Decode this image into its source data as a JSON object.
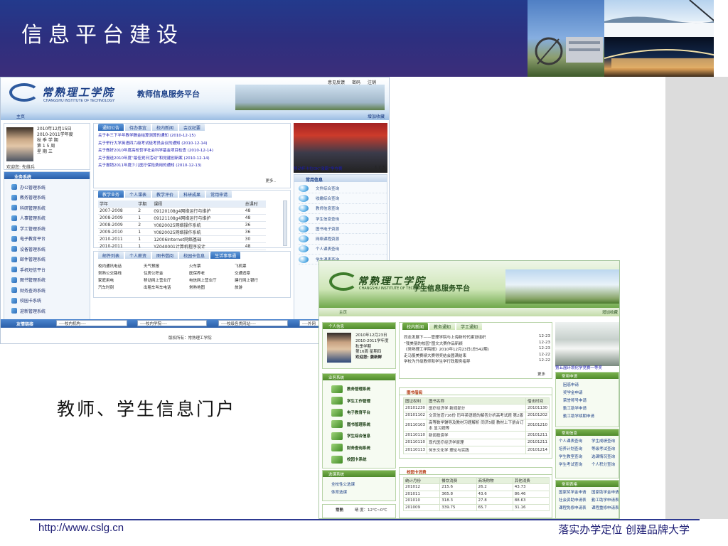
{
  "slide": {
    "title": "信息平台建设",
    "caption": "教师、学生信息门户",
    "footer_url": "http://www.cslg.cn",
    "footer_motto": "落实办学定位 创建品牌大学"
  },
  "teacher_portal": {
    "school_name": "常熟理工学院",
    "school_name_en": "CHANGSHU INSTITUTE OF TECHNOLOGY",
    "system_name": "教师信息服务平台",
    "top_links": [
      "意见反馈",
      "密码",
      "注销"
    ],
    "nav_home": "主页",
    "nav_favorite": "增加收藏",
    "info": {
      "date_lines": [
        "2010年12月15日",
        "2010-2011学年度",
        "秋 季 学 期",
        "第 1 5 周",
        "星 期 三"
      ],
      "welcome": "欢迎您: 先维兵"
    },
    "business": {
      "header": "业务系统",
      "items": [
        "办公管理系统",
        "教务管理系统",
        "科研管理系统",
        "人事管理系统",
        "学工管理系统",
        "电子教育平台",
        "设备管理系统",
        "邮件管理系统",
        "手机短信平台",
        "图书管理系统",
        "财务查询系统",
        "校园卡系统",
        "迎新管理系统"
      ]
    },
    "notice_tabs": [
      "通知公告",
      "待办事宜",
      "校内新闻",
      "会议纪要"
    ],
    "notices": [
      "关于丰三下半年教学酬金结算测算的通知 (2010-12-15)",
      "关于举行大学英语四六级考试徒考员会议的通知 (2010-12-14)",
      "关于做好2010年度高校哲学社会科学基金项目检查 (2010-12-14)",
      "关于报送2010年度“最佳党日活动”和党建创新案 (2010-12-14)",
      "关于报销2011年度少儿医疗保险费用的通知 (2010-12-13)"
    ],
    "notice_more": "更多..",
    "photo_caption": "移动杯卡拉OK“激霸”争夺赛",
    "photo_pages": "1 2 3",
    "course_tabs": [
      "教学业务",
      "个人课表",
      "教学评价",
      "科研成果",
      "常用申请"
    ],
    "course_table": {
      "headers": [
        "学年",
        "学期",
        "课程",
        "总课时"
      ],
      "rows": [
        [
          "2007-2008",
          "2",
          "09120108g4网络运行与维护",
          "48"
        ],
        [
          "2008-2009",
          "1",
          "09121108g4网络运行与维护",
          "48"
        ],
        [
          "2008-2009",
          "2",
          "Y0820025网络操作系统",
          "36"
        ],
        [
          "2009-2010",
          "1",
          "Y0820025网络操作系统",
          "36"
        ],
        [
          "2010-2011",
          "1",
          "12006Internet网络基础",
          "30"
        ],
        [
          "2010-2011",
          "1",
          "YZ040001计算机程序设计",
          "48"
        ]
      ]
    },
    "link_tabs": [
      "邮件列表",
      "个人薪资",
      "图书借阅",
      "校园卡信息",
      "生活事事通"
    ],
    "life_links": [
      "校内通讯电话",
      "天气预报",
      "火车票",
      "飞机票",
      "常熟公交路线",
      "住房公积金",
      "医保养老",
      "交通违章",
      "家庭用电",
      "移动网上营业厅",
      "电信网上营业厅",
      "建行网上银行",
      "汽车时刻",
      "出租车叫车电话",
      "常熟地图",
      "旅游"
    ],
    "friend_links": {
      "label": "友情链接",
      "selects": [
        "----校内机构----",
        "----校内学院----",
        "----校级各类网站----",
        "----外网"
      ]
    },
    "common": {
      "header": "常用信息",
      "items": [
        "文件综合查询",
        "收缴综合查询",
        "教师信息查询",
        "学生信息查询",
        "图书电子资源",
        "网络课程资源",
        "个人课表查询",
        "学生课表查询"
      ]
    },
    "copyright": "版权所有：常熟理工学院"
  },
  "student_portal": {
    "school_name": "常熟理工学院",
    "school_name_en": "CHANGSHU INSTITUTE OF TECHNOLOGY",
    "system_name": "学生信息服务平台",
    "nav_home": "主页",
    "nav_favorite": "增加收藏",
    "info": {
      "header": "个人信息",
      "date_lines": [
        "2010年12月23日",
        "2010-2011学年度",
        "秋季学期",
        "第16周 星期四"
      ],
      "welcome": "欢迎您: 姜新鲜"
    },
    "business": {
      "header": "业务系统",
      "items": [
        "教务管理系统",
        "学生工作管理",
        "电子教育平台",
        "图书管理系统",
        "学生综合信息",
        "财务查询系统",
        "校园卡系统"
      ]
    },
    "select_course": {
      "header": "选课系统",
      "items": [
        "全校性公选课",
        "体育选课"
      ]
    },
    "weather": {
      "label": "常熟",
      "text": "晴 度：12℃~0℃"
    },
    "news_tabs": [
      "校内新闻",
      "教务通知",
      "学工通知"
    ],
    "news": [
      {
        "title": "同走发展下——管理学院与上海新时代建设组织",
        "date": "12-23"
      },
      {
        "title": "“我美丽的校园”图文大赛作品新颖",
        "date": "12-23"
      },
      {
        "title": "《常熟理工学院报》2010年12月23日(总542期)",
        "date": "12-23"
      },
      {
        "title": "走马服美赛绩大赛得奖结会圆满结束",
        "date": "12-22"
      },
      {
        "title": "学校为升级教师和学生学行政服务指导",
        "date": "12-22"
      }
    ],
    "news_more": "更多",
    "photo_caption": "第五届环境化学竞赛一等奖",
    "library": {
      "header": "图书借阅",
      "headers": [
        "图证权利",
        "图书名称",
        "借出时间"
      ],
      "rows": [
        [
          "20101230",
          "医疗经济学 新闻部分",
          "20101130"
        ],
        [
          "20101102",
          "交流信道716份 历年英语题的解答分析高考试题 第2版",
          "20101202"
        ],
        [
          "20110103",
          "高等数学辅导及教材习题解析 同济5版 教材上下册合订本 显习题等",
          "20101210"
        ],
        [
          "20110110",
          "新闻投资学",
          "20101211"
        ],
        [
          "20110110",
          "现代医疗经济学原理",
          "20101211"
        ],
        [
          "20110113",
          "何东文化学 理论与实践",
          "20101214"
        ]
      ]
    },
    "campus_card": {
      "header": "校园卡消费",
      "headers": [
        "统计月份",
        "餐饮消费",
        "商场购物",
        "其他消费"
      ],
      "rows": [
        [
          "201012",
          "215.6",
          "26.2",
          "43.73"
        ],
        [
          "201011",
          "365.8",
          "43.6",
          "86.46"
        ],
        [
          "201010",
          "318.3",
          "27.8",
          "88.63"
        ],
        [
          "201009",
          "339.75",
          "65.7",
          "31.16"
        ]
      ]
    },
    "apply": {
      "header": "常用申请",
      "items": [
        "困惑申请",
        "奖学金申请",
        "荣誉称号申请",
        "勤工助学申请",
        "勤工助学续期申请"
      ]
    },
    "common_info": {
      "header": "常用信息",
      "items": [
        "个人课表查询",
        "学生成绩查询",
        "培养计划查询",
        "等级考试查询",
        "学生教室查询",
        "选课情况查询",
        "学生考试查询",
        "个人积分查询"
      ]
    },
    "forms": {
      "header": "常用表格",
      "items": [
        "国家奖学金申请",
        "国家助学金申请",
        "社会资助申请表",
        "勤工助学申请表",
        "课程免修申请表",
        "课程重修申请表"
      ]
    }
  }
}
